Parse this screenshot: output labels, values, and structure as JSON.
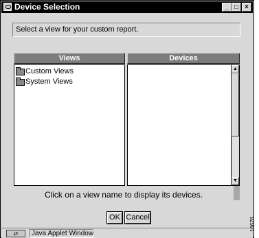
{
  "window": {
    "title": "Device Selection"
  },
  "instruction": "Select a view for your custom report.",
  "views": {
    "header": "Views",
    "items": [
      {
        "label": "Custom Views",
        "icon": "folder-icon"
      },
      {
        "label": "System Views",
        "icon": "folder-icon"
      }
    ]
  },
  "devices": {
    "header": "Devices",
    "items": []
  },
  "hint": "Click on a view name to display its devices.",
  "buttons": {
    "ok": "OK",
    "cancel": "Cancel"
  },
  "status": {
    "applet_label": "Java Applet Window"
  },
  "figure_number": "16676"
}
